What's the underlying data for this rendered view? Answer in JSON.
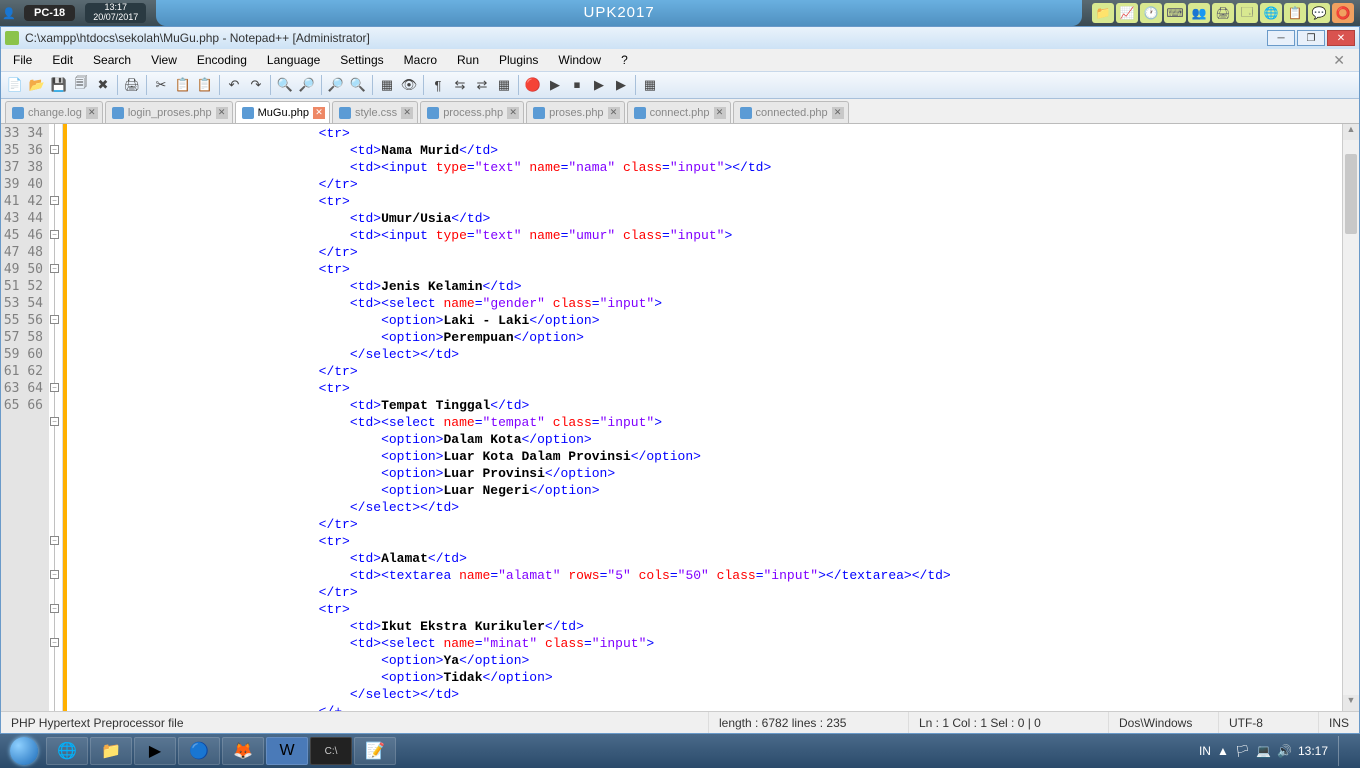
{
  "sysbar": {
    "pc": "PC-18",
    "time": "13:17",
    "date": "20/07/2017",
    "title": "UPK2017"
  },
  "window_title": "C:\\xampp\\htdocs\\sekolah\\MuGu.php - Notepad++ [Administrator]",
  "menus": [
    "File",
    "Edit",
    "Search",
    "View",
    "Encoding",
    "Language",
    "Settings",
    "Macro",
    "Run",
    "Plugins",
    "Window",
    "?"
  ],
  "tabs": [
    {
      "name": "change.log",
      "active": false
    },
    {
      "name": "login_proses.php",
      "active": false
    },
    {
      "name": "MuGu.php",
      "active": true
    },
    {
      "name": "style.css",
      "active": false
    },
    {
      "name": "process.php",
      "active": false
    },
    {
      "name": "proses.php",
      "active": false
    },
    {
      "name": "connect.php",
      "active": false
    },
    {
      "name": "connected.php",
      "active": false
    }
  ],
  "line_start": 33,
  "line_count": 34,
  "fold_lines": [
    34,
    37,
    39,
    41,
    44,
    48,
    50,
    57,
    59,
    61,
    63
  ],
  "code_lines": [
    [
      [
        "ws",
        "                                "
      ],
      [
        "tag",
        "<tr>"
      ]
    ],
    [
      [
        "ws",
        "                                    "
      ],
      [
        "tag",
        "<td>"
      ],
      [
        "txt",
        "Nama Murid"
      ],
      [
        "tag",
        "</td>"
      ]
    ],
    [
      [
        "ws",
        "                                    "
      ],
      [
        "tag",
        "<td><input"
      ],
      [
        "ws",
        " "
      ],
      [
        "attr",
        "type"
      ],
      [
        "eq",
        "="
      ],
      [
        "str",
        "\"text\""
      ],
      [
        "ws",
        " "
      ],
      [
        "attr",
        "name"
      ],
      [
        "eq",
        "="
      ],
      [
        "str",
        "\"nama\""
      ],
      [
        "ws",
        " "
      ],
      [
        "attr",
        "class"
      ],
      [
        "eq",
        "="
      ],
      [
        "str",
        "\"input\""
      ],
      [
        "tag",
        "></td>"
      ]
    ],
    [
      [
        "ws",
        "                                "
      ],
      [
        "tag",
        "</tr>"
      ]
    ],
    [
      [
        "ws",
        "                                "
      ],
      [
        "tag",
        "<tr>"
      ]
    ],
    [
      [
        "ws",
        "                                    "
      ],
      [
        "tag",
        "<td>"
      ],
      [
        "txt",
        "Umur/Usia"
      ],
      [
        "tag",
        "</td>"
      ]
    ],
    [
      [
        "ws",
        "                                    "
      ],
      [
        "tag",
        "<td><input"
      ],
      [
        "ws",
        " "
      ],
      [
        "attr",
        "type"
      ],
      [
        "eq",
        "="
      ],
      [
        "str",
        "\"text\""
      ],
      [
        "ws",
        " "
      ],
      [
        "attr",
        "name"
      ],
      [
        "eq",
        "="
      ],
      [
        "str",
        "\"umur\""
      ],
      [
        "ws",
        " "
      ],
      [
        "attr",
        "class"
      ],
      [
        "eq",
        "="
      ],
      [
        "str",
        "\"input\""
      ],
      [
        "tag",
        ">"
      ]
    ],
    [
      [
        "ws",
        "                                "
      ],
      [
        "tag",
        "</tr>"
      ]
    ],
    [
      [
        "ws",
        "                                "
      ],
      [
        "tag",
        "<tr>"
      ]
    ],
    [
      [
        "ws",
        "                                    "
      ],
      [
        "tag",
        "<td>"
      ],
      [
        "txt",
        "Jenis Kelamin"
      ],
      [
        "tag",
        "</td>"
      ]
    ],
    [
      [
        "ws",
        "                                    "
      ],
      [
        "tag",
        "<td><select"
      ],
      [
        "ws",
        " "
      ],
      [
        "attr",
        "name"
      ],
      [
        "eq",
        "="
      ],
      [
        "str",
        "\"gender\""
      ],
      [
        "ws",
        " "
      ],
      [
        "attr",
        "class"
      ],
      [
        "eq",
        "="
      ],
      [
        "str",
        "\"input\""
      ],
      [
        "tag",
        ">"
      ]
    ],
    [
      [
        "ws",
        "                                        "
      ],
      [
        "tag",
        "<option>"
      ],
      [
        "txt",
        "Laki - Laki"
      ],
      [
        "tag",
        "</option>"
      ]
    ],
    [
      [
        "ws",
        "                                        "
      ],
      [
        "tag",
        "<option>"
      ],
      [
        "txt",
        "Perempuan"
      ],
      [
        "tag",
        "</option>"
      ]
    ],
    [
      [
        "ws",
        "                                    "
      ],
      [
        "tag",
        "</select></td>"
      ]
    ],
    [
      [
        "ws",
        "                                "
      ],
      [
        "tag",
        "</tr>"
      ]
    ],
    [
      [
        "ws",
        "                                "
      ],
      [
        "tag",
        "<tr>"
      ]
    ],
    [
      [
        "ws",
        "                                    "
      ],
      [
        "tag",
        "<td>"
      ],
      [
        "txt",
        "Tempat Tinggal"
      ],
      [
        "tag",
        "</td>"
      ]
    ],
    [
      [
        "ws",
        "                                    "
      ],
      [
        "tag",
        "<td><select"
      ],
      [
        "ws",
        " "
      ],
      [
        "attr",
        "name"
      ],
      [
        "eq",
        "="
      ],
      [
        "str",
        "\"tempat\""
      ],
      [
        "ws",
        " "
      ],
      [
        "attr",
        "class"
      ],
      [
        "eq",
        "="
      ],
      [
        "str",
        "\"input\""
      ],
      [
        "tag",
        ">"
      ]
    ],
    [
      [
        "ws",
        "                                        "
      ],
      [
        "tag",
        "<option>"
      ],
      [
        "txt",
        "Dalam Kota"
      ],
      [
        "tag",
        "</option>"
      ]
    ],
    [
      [
        "ws",
        "                                        "
      ],
      [
        "tag",
        "<option>"
      ],
      [
        "txt",
        "Luar Kota Dalam Provinsi"
      ],
      [
        "tag",
        "</option>"
      ]
    ],
    [
      [
        "ws",
        "                                        "
      ],
      [
        "tag",
        "<option>"
      ],
      [
        "txt",
        "Luar Provinsi"
      ],
      [
        "tag",
        "</option>"
      ]
    ],
    [
      [
        "ws",
        "                                        "
      ],
      [
        "tag",
        "<option>"
      ],
      [
        "txt",
        "Luar Negeri"
      ],
      [
        "tag",
        "</option>"
      ]
    ],
    [
      [
        "ws",
        "                                    "
      ],
      [
        "tag",
        "</select></td>"
      ]
    ],
    [
      [
        "ws",
        "                                "
      ],
      [
        "tag",
        "</tr>"
      ]
    ],
    [
      [
        "ws",
        "                                "
      ],
      [
        "tag",
        "<tr>"
      ]
    ],
    [
      [
        "ws",
        "                                    "
      ],
      [
        "tag",
        "<td>"
      ],
      [
        "txt",
        "Alamat"
      ],
      [
        "tag",
        "</td>"
      ]
    ],
    [
      [
        "ws",
        "                                    "
      ],
      [
        "tag",
        "<td><textarea"
      ],
      [
        "ws",
        " "
      ],
      [
        "attr",
        "name"
      ],
      [
        "eq",
        "="
      ],
      [
        "str",
        "\"alamat\""
      ],
      [
        "ws",
        " "
      ],
      [
        "attr",
        "rows"
      ],
      [
        "eq",
        "="
      ],
      [
        "str",
        "\"5\""
      ],
      [
        "ws",
        " "
      ],
      [
        "attr",
        "cols"
      ],
      [
        "eq",
        "="
      ],
      [
        "str",
        "\"50\""
      ],
      [
        "ws",
        " "
      ],
      [
        "attr",
        "class"
      ],
      [
        "eq",
        "="
      ],
      [
        "str",
        "\"input\""
      ],
      [
        "tag",
        "></textarea></td>"
      ]
    ],
    [
      [
        "ws",
        "                                "
      ],
      [
        "tag",
        "</tr>"
      ]
    ],
    [
      [
        "ws",
        "                                "
      ],
      [
        "tag",
        "<tr>"
      ]
    ],
    [
      [
        "ws",
        "                                    "
      ],
      [
        "tag",
        "<td>"
      ],
      [
        "txt",
        "Ikut Ekstra Kurikuler"
      ],
      [
        "tag",
        "</td>"
      ]
    ],
    [
      [
        "ws",
        "                                    "
      ],
      [
        "tag",
        "<td><select"
      ],
      [
        "ws",
        " "
      ],
      [
        "attr",
        "name"
      ],
      [
        "eq",
        "="
      ],
      [
        "str",
        "\"minat\""
      ],
      [
        "ws",
        " "
      ],
      [
        "attr",
        "class"
      ],
      [
        "eq",
        "="
      ],
      [
        "str",
        "\"input\""
      ],
      [
        "tag",
        ">"
      ]
    ],
    [
      [
        "ws",
        "                                        "
      ],
      [
        "tag",
        "<option>"
      ],
      [
        "txt",
        "Ya"
      ],
      [
        "tag",
        "</option>"
      ]
    ],
    [
      [
        "ws",
        "                                        "
      ],
      [
        "tag",
        "<option>"
      ],
      [
        "txt",
        "Tidak"
      ],
      [
        "tag",
        "</option>"
      ]
    ],
    [
      [
        "ws",
        "                                    "
      ],
      [
        "tag",
        "</select></td>"
      ]
    ],
    [
      [
        "ws",
        "                                "
      ],
      [
        "tag",
        "</+"
      ]
    ]
  ],
  "status": {
    "lang": "PHP Hypertext Preprocessor file",
    "len": "length : 6782    lines : 235",
    "pos": "Ln : 1    Col : 1    Sel : 0 | 0",
    "eol": "Dos\\Windows",
    "enc": "UTF-8",
    "ins": "INS"
  },
  "taskbar_time": "13:17",
  "taskbar_lang": "IN"
}
